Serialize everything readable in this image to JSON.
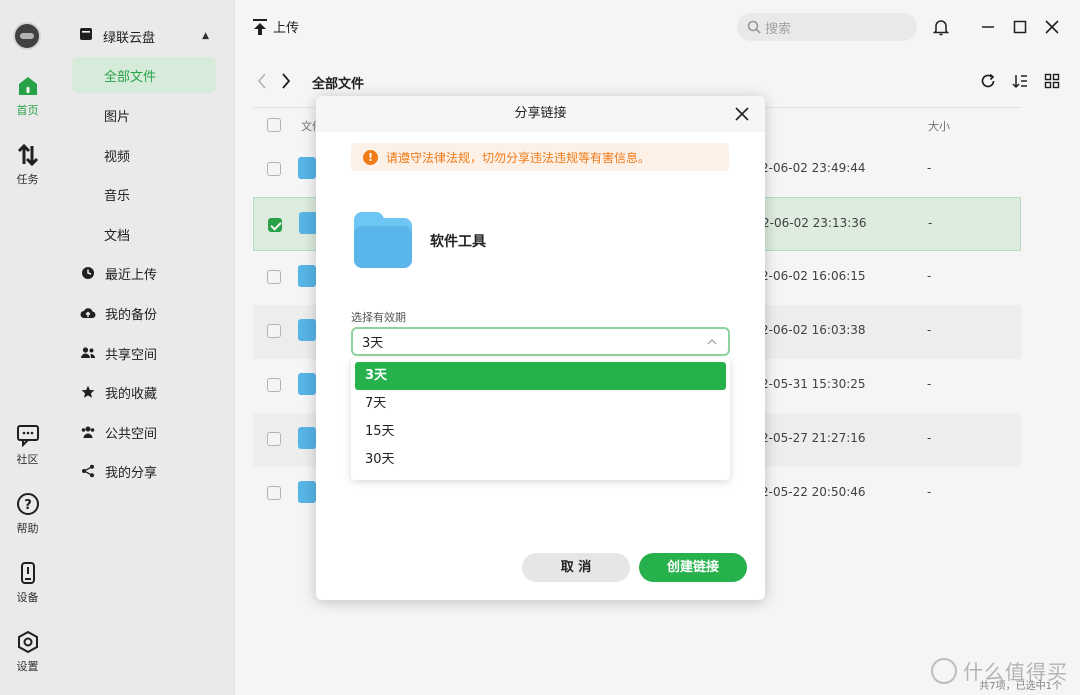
{
  "rail": {
    "items": [
      {
        "label": "首页",
        "icon": "home-icon",
        "active": true
      },
      {
        "label": "任务",
        "icon": "transfer-icon"
      },
      {
        "label": "社区",
        "icon": "chat-icon"
      },
      {
        "label": "帮助",
        "icon": "help-icon"
      },
      {
        "label": "设备",
        "icon": "device-icon"
      },
      {
        "label": "设置",
        "icon": "settings-icon"
      }
    ]
  },
  "nav": {
    "root": "绿联云盘",
    "items": [
      {
        "label": "全部文件",
        "active": true
      },
      {
        "label": "图片"
      },
      {
        "label": "视频"
      },
      {
        "label": "音乐"
      },
      {
        "label": "文档"
      },
      {
        "label": "最近上传",
        "icon": "clock-icon"
      },
      {
        "label": "我的备份",
        "icon": "cloud-upload-icon"
      },
      {
        "label": "共享空间",
        "icon": "users-icon"
      },
      {
        "label": "我的收藏",
        "icon": "star-icon"
      },
      {
        "label": "公共空间",
        "icon": "group-icon"
      },
      {
        "label": "我的分享",
        "icon": "share-icon"
      }
    ]
  },
  "toolbar": {
    "upload_label": "上传",
    "search_placeholder": "搜索"
  },
  "pathbar": {
    "crumb": "全部文件"
  },
  "list": {
    "columns": {
      "name": "文件",
      "size": "大小"
    },
    "rows": [
      {
        "date": "2-06-02 23:49:44",
        "size": "-",
        "checked": false
      },
      {
        "date": "2-06-02 23:13:36",
        "size": "-",
        "checked": true
      },
      {
        "date": "2-06-02 16:06:15",
        "size": "-",
        "checked": false
      },
      {
        "date": "2-06-02 16:03:38",
        "size": "-",
        "checked": false
      },
      {
        "date": "2-05-31 15:30:25",
        "size": "-",
        "checked": false
      },
      {
        "date": "2-05-27 21:27:16",
        "size": "-",
        "checked": false
      },
      {
        "date": "2-05-22 20:50:46",
        "size": "-",
        "checked": false
      }
    ]
  },
  "status_text": "共7项，已选中1个",
  "dialog": {
    "title": "分享链接",
    "warning": "请遵守法律法规，切勿分享违法违规等有害信息。",
    "file_name": "软件工具",
    "validity_label": "选择有效期",
    "selected_validity": "3天",
    "options": [
      "3天",
      "7天",
      "15天",
      "30天"
    ],
    "cancel_label": "取 消",
    "create_label": "创建链接"
  },
  "watermark": "什么值得买",
  "colors": {
    "accent": "#26b14c",
    "warning": "#f07a18",
    "folder": "#5ab5ea"
  }
}
